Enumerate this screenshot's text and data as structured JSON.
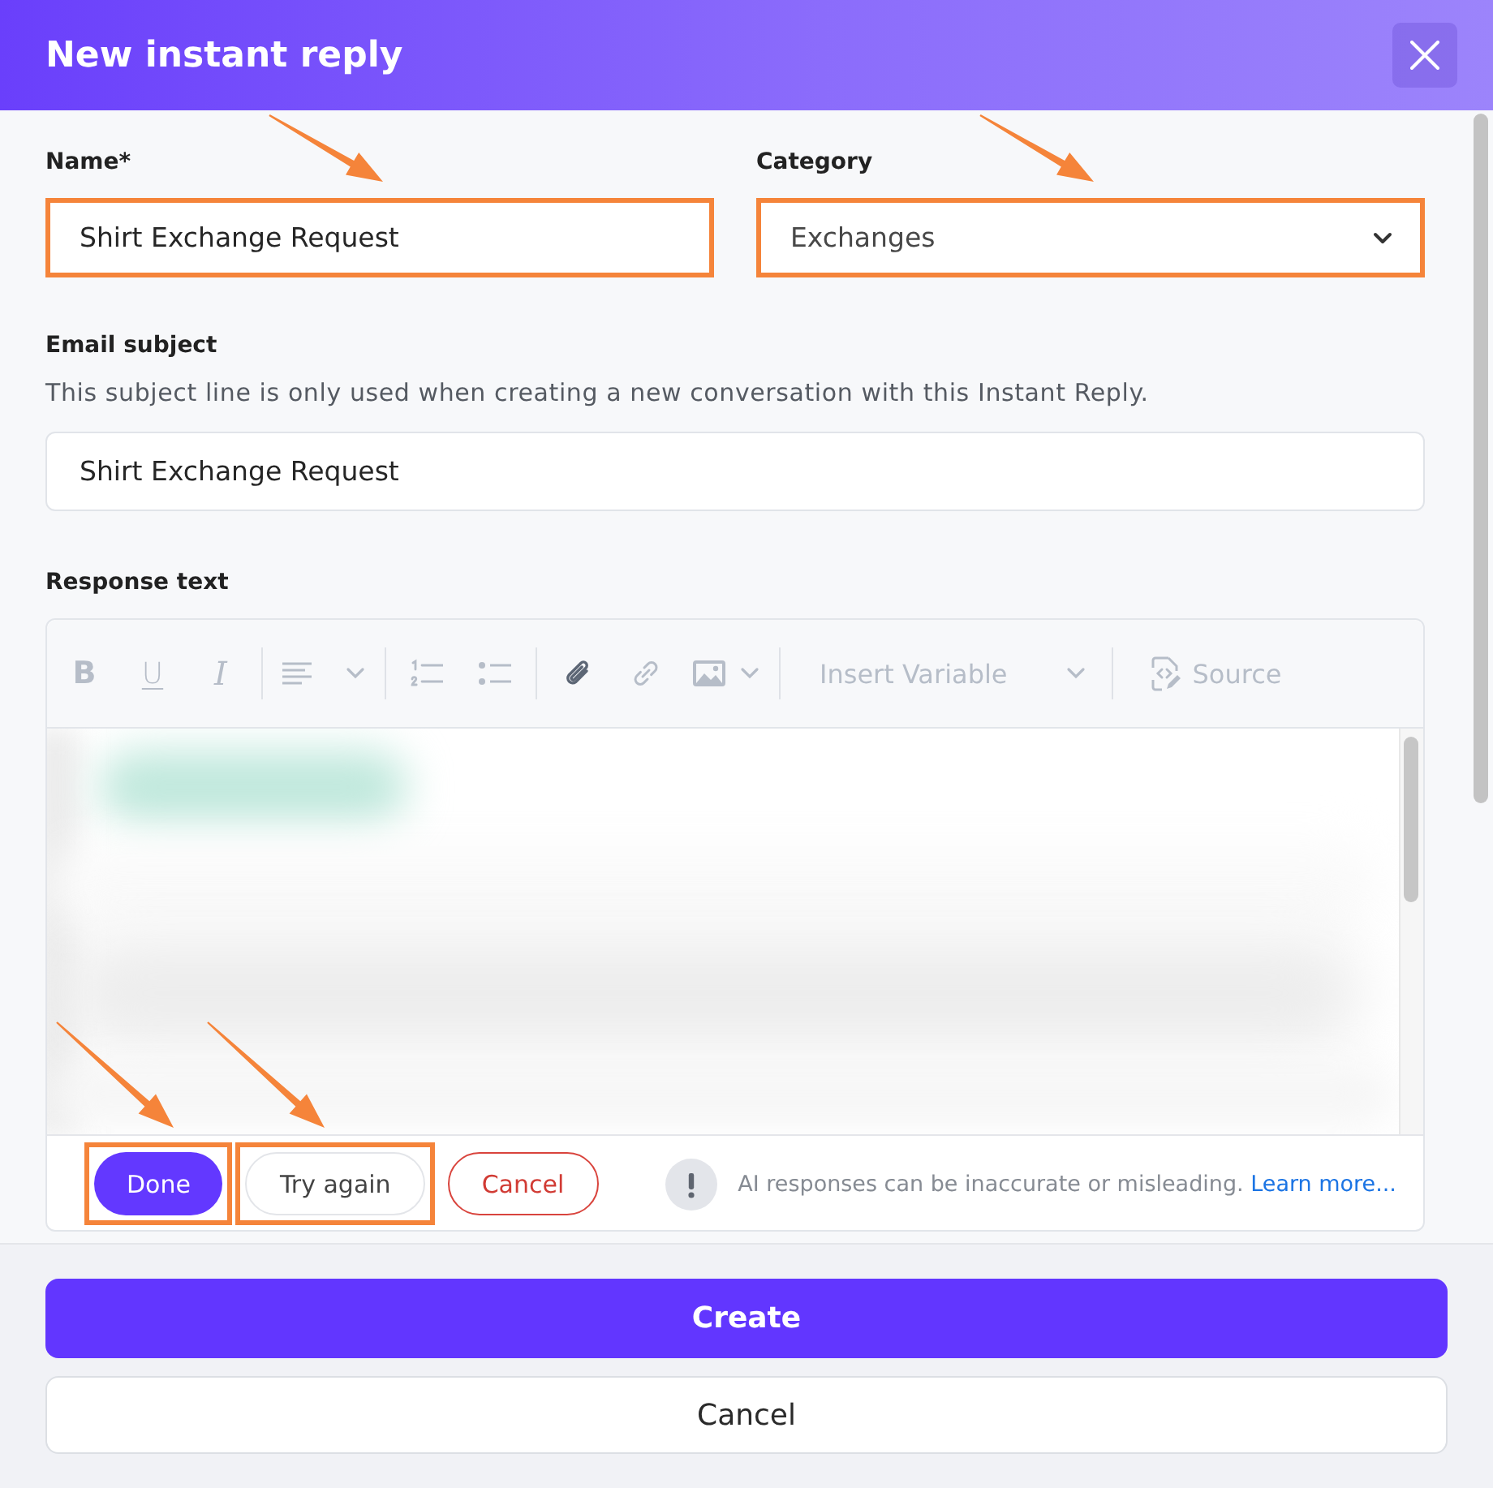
{
  "dialog": {
    "title": "New instant reply"
  },
  "name_field": {
    "label": "Name*",
    "value": "Shirt Exchange Request",
    "highlighted": true
  },
  "category_field": {
    "label": "Category",
    "value": "Exchanges",
    "highlighted": true
  },
  "subject_field": {
    "label": "Email subject",
    "hint": "This subject line is only used when creating a new conversation with this Instant Reply.",
    "value": "Shirt Exchange Request",
    "highlighted": false
  },
  "response": {
    "label": "Response text",
    "toolbar": [
      [
        {
          "kind": "bold",
          "glyph": "B",
          "disabled": true
        },
        {
          "kind": "underline",
          "glyph": "U",
          "disabled": true
        },
        {
          "kind": "italic",
          "glyph": "I",
          "disabled": true
        }
      ],
      [
        {
          "kind": "align",
          "disabled": true
        }
      ],
      [
        {
          "kind": "numbered_list",
          "disabled": true
        },
        {
          "kind": "bullet_list",
          "disabled": true
        }
      ],
      [
        {
          "kind": "attach",
          "disabled": false
        },
        {
          "kind": "link",
          "disabled": true
        },
        {
          "kind": "image",
          "disabled": true
        }
      ],
      [
        {
          "kind": "variable",
          "label": "Insert Variable",
          "disabled": true
        }
      ],
      [
        {
          "kind": "source",
          "label": "Source",
          "disabled": true
        }
      ]
    ],
    "actions": [
      {
        "kind": "primary",
        "label": "Done",
        "highlighted": true
      },
      {
        "kind": "secondary",
        "label": "Try again",
        "highlighted": true
      },
      {
        "kind": "danger",
        "label": "Cancel",
        "highlighted": false
      }
    ],
    "notice": {
      "text": "AI responses can be inaccurate or misleading.",
      "link": "Learn more..."
    }
  },
  "footer": {
    "buttons": [
      {
        "kind": "primary",
        "label": "Create"
      },
      {
        "kind": "secondary",
        "label": "Cancel"
      }
    ]
  }
}
